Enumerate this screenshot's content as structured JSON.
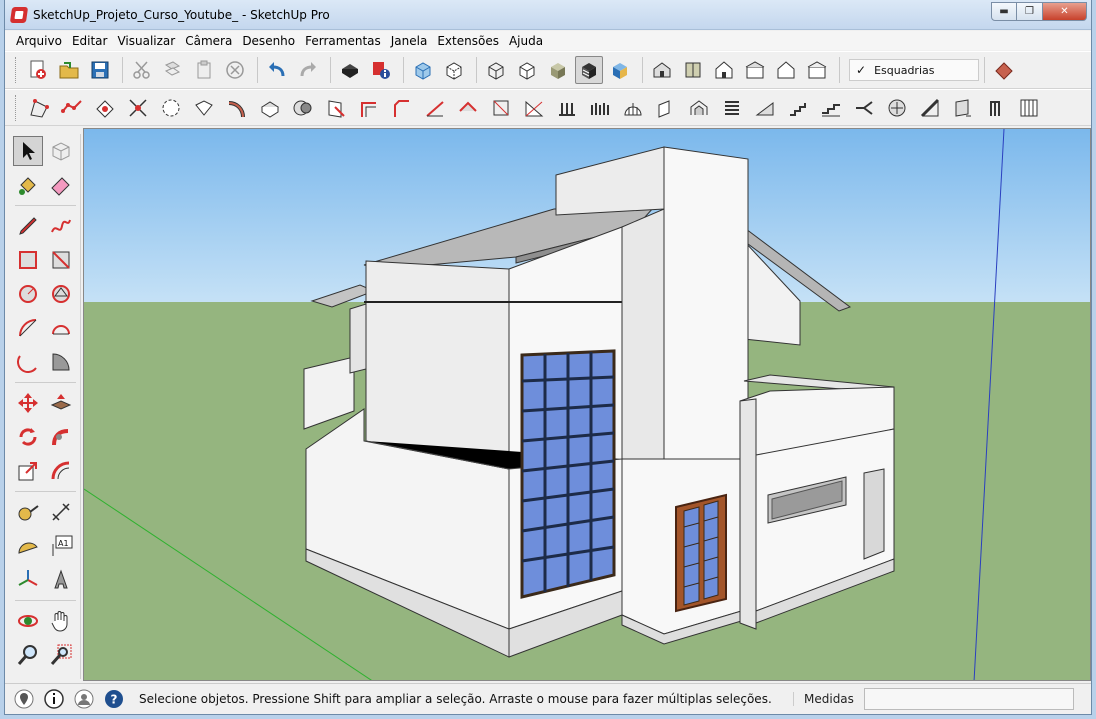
{
  "window": {
    "title": "SketchUp_Projeto_Curso_Youtube_ - SketchUp Pro"
  },
  "menu": [
    "Arquivo",
    "Editar",
    "Visualizar",
    "Câmera",
    "Desenho",
    "Ferramentas",
    "Janela",
    "Extensões",
    "Ajuda"
  ],
  "toolbar_top": {
    "guides_checkbox_label": "Esquadrias",
    "guides_checked": true
  },
  "left_toolbar": {
    "text_tool_label": "A1"
  },
  "statusbar": {
    "hint": "Selecione objetos. Pressione Shift para ampliar a seleção. Arraste o mouse para fazer múltiplas seleções.",
    "measurements_label": "Medidas",
    "measurements_value": ""
  },
  "colors": {
    "sky": "#8ec3ef",
    "ground": "#95b57f",
    "wall": "#f2f2f2",
    "roof": "#b5b5b5",
    "glass": "#6e8edb",
    "door": "#a3552a",
    "accent_red": "#d63030"
  }
}
